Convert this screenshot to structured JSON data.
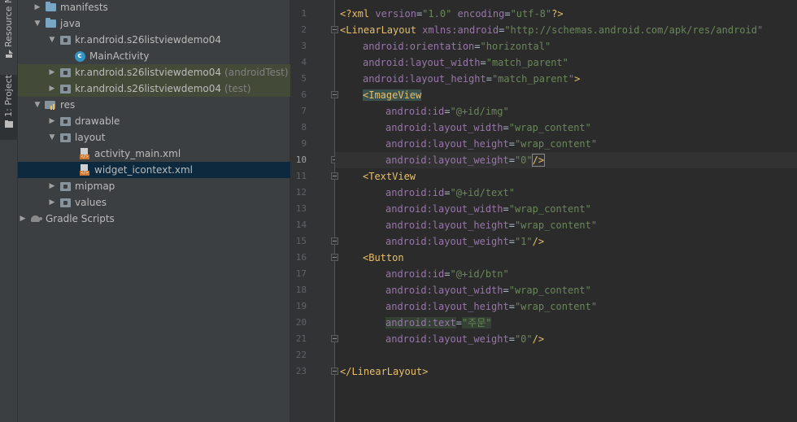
{
  "toolstrip": {
    "resource_manager_label": "Resource M",
    "project_label": "1: Project"
  },
  "tree": [
    {
      "label": "manifests",
      "suffix": "",
      "icon": "folder-icon",
      "arrow": "collapsed"
    },
    {
      "label": "java",
      "suffix": "",
      "icon": "folder-icon",
      "arrow": "expanded"
    },
    {
      "label": "kr.android.s26listviewdemo04",
      "suffix": "",
      "icon": "package-icon",
      "arrow": "expanded"
    },
    {
      "label": "MainActivity",
      "suffix": "",
      "icon": "class-icon",
      "arrow": "none"
    },
    {
      "label": "kr.android.s26listviewdemo04",
      "suffix": "(androidTest)",
      "icon": "package-icon",
      "arrow": "collapsed"
    },
    {
      "label": "kr.android.s26listviewdemo04",
      "suffix": "(test)",
      "icon": "package-icon",
      "arrow": "collapsed"
    },
    {
      "label": "res",
      "suffix": "",
      "icon": "res-folder-icon",
      "arrow": "expanded"
    },
    {
      "label": "drawable",
      "suffix": "",
      "icon": "folder-icon",
      "arrow": "collapsed"
    },
    {
      "label": "layout",
      "suffix": "",
      "icon": "folder-icon",
      "arrow": "expanded"
    },
    {
      "label": "activity_main.xml",
      "suffix": "",
      "icon": "xml-file-icon",
      "arrow": "none"
    },
    {
      "label": "widget_icontext.xml",
      "suffix": "",
      "icon": "xml-file-icon",
      "arrow": "none"
    },
    {
      "label": "mipmap",
      "suffix": "",
      "icon": "folder-icon",
      "arrow": "collapsed"
    },
    {
      "label": "values",
      "suffix": "",
      "icon": "folder-icon",
      "arrow": "collapsed"
    },
    {
      "label": "Gradle Scripts",
      "suffix": "",
      "icon": "gradle-icon",
      "arrow": "collapsed"
    }
  ],
  "editor": {
    "current_line": 10,
    "line_numbers": [
      "1",
      "2",
      "3",
      "4",
      "5",
      "6",
      "7",
      "8",
      "9",
      "10",
      "11",
      "12",
      "13",
      "14",
      "15",
      "16",
      "17",
      "18",
      "19",
      "20",
      "21",
      "22",
      "23"
    ],
    "lines": {
      "l1": {
        "pi_open": "<?xml ",
        "version_attr": "version",
        "eq": "=",
        "version_val": "\"1.0\"",
        "space": " ",
        "enc_attr": "encoding",
        "enc_val": "\"utf-8\"",
        "pi_close": "?>"
      },
      "l2": {
        "tag": "<LinearLayout",
        "attr": " xmlns:android",
        "eq": "=",
        "val": "\"http://schemas.android.com/apk/res/android\""
      },
      "l3": {
        "attr": "android:orientation",
        "eq": "=",
        "val": "\"horizontal\""
      },
      "l4": {
        "attr": "android:layout_width",
        "eq": "=",
        "val": "\"match_parent\""
      },
      "l5": {
        "attr": "android:layout_height",
        "eq": "=",
        "val": "\"match_parent\"",
        "close": ">"
      },
      "l6": {
        "tag": "<ImageView"
      },
      "l7": {
        "attr": "android:id",
        "eq": "=",
        "val": "\"@+id/img\""
      },
      "l8": {
        "attr": "android:layout_width",
        "eq": "=",
        "val": "\"wrap_content\""
      },
      "l9": {
        "attr": "android:layout_height",
        "eq": "=",
        "val": "\"wrap_content\""
      },
      "l10": {
        "attr": "android:layout_weight",
        "eq": "=",
        "val": "\"0\"",
        "close": "/>"
      },
      "l11": {
        "tag": "<TextView"
      },
      "l12": {
        "attr": "android:id",
        "eq": "=",
        "val": "\"@+id/text\""
      },
      "l13": {
        "attr": "android:layout_width",
        "eq": "=",
        "val": "\"wrap_content\""
      },
      "l14": {
        "attr": "android:layout_height",
        "eq": "=",
        "val": "\"wrap_content\""
      },
      "l15": {
        "attr": "android:layout_weight",
        "eq": "=",
        "val": "\"1\"",
        "close": "/>"
      },
      "l16": {
        "tag": "<Button"
      },
      "l17": {
        "attr": "android:id",
        "eq": "=",
        "val": "\"@+id/btn\""
      },
      "l18": {
        "attr": "android:layout_width",
        "eq": "=",
        "val": "\"wrap_content\""
      },
      "l19": {
        "attr": "android:layout_height",
        "eq": "=",
        "val": "\"wrap_content\""
      },
      "l20": {
        "attr": "android:text",
        "eq": "=",
        "val": "\"주문\""
      },
      "l21": {
        "attr": "android:layout_weight",
        "eq": "=",
        "val": "\"0\"",
        "close": "/>"
      },
      "l23": {
        "tag": "</LinearLayout>"
      }
    }
  },
  "colors": {
    "tag": "#e8bf6a",
    "attribute": "#9876aa",
    "value": "#6a8759",
    "selection": "#0d293e",
    "highlight_row": "#434b38"
  }
}
